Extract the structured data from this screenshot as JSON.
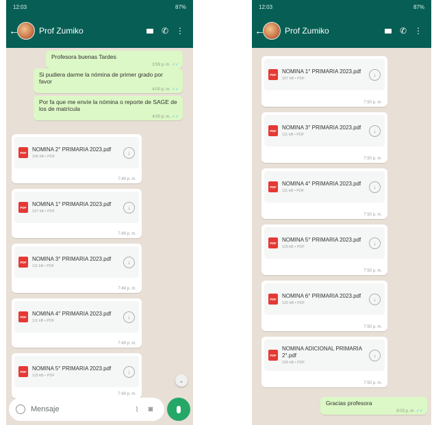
{
  "left": {
    "status_time": "12:03",
    "status_right": "87%",
    "contact_name": "Prof Zumiko",
    "text_messages": [
      {
        "text": "Profesora buenas Tardes",
        "time": "3:59 p. m."
      },
      {
        "text": "Si pudiera darme la nómina de primer grado por favor",
        "time": "4:00 p. m."
      },
      {
        "text": "Por fa que me envíe la nómina o reporte de SAGE de los de matrícula",
        "time": "4:00 p. m."
      }
    ],
    "documents": [
      {
        "name": "NOMINA 2° PRIMARIA 2023.pdf",
        "meta": "106 kB • PDF",
        "time": "7:49 p. m."
      },
      {
        "name": "NOMINA 1° PRIMARIA 2023.pdf",
        "meta": "107 kB • PDF",
        "time": "7:49 p. m."
      },
      {
        "name": "NOMINA 3° PRIMARIA 2023.pdf",
        "meta": "111 kB • PDF",
        "time": "7:49 p. m."
      },
      {
        "name": "NOMINA 4° PRIMARIA 2023.pdf",
        "meta": "111 kB • PDF",
        "time": "7:49 p. m."
      },
      {
        "name": "NOMINA 5° PRIMARIA 2023.pdf",
        "meta": "115 kB • PDF",
        "time": "7:49 p. m."
      }
    ],
    "input_placeholder": "Mensaje"
  },
  "right": {
    "status_time": "12:03",
    "status_right": "87%",
    "contact_name": "Prof Zumiko",
    "documents": [
      {
        "name": "NOMINA 1° PRIMARIA 2023.pdf",
        "meta": "107 kB • PDF",
        "time": "7:50 p. m."
      },
      {
        "name": "NOMINA 3° PRIMARIA 2023.pdf",
        "meta": "111 kB • PDF",
        "time": "7:50 p. m."
      },
      {
        "name": "NOMINA 4° PRIMARIA 2023.pdf",
        "meta": "111 kB • PDF",
        "time": "7:50 p. m."
      },
      {
        "name": "NOMINA 5° PRIMARIA 2023.pdf",
        "meta": "115 kB • PDF",
        "time": "7:50 p. m."
      },
      {
        "name": "NOMINA 6° PRIMARIA 2023.pdf",
        "meta": "120 kB • PDF",
        "time": "7:50 p. m."
      },
      {
        "name": "NOMINA ADICIONAL PRIMARIA 2°.pdf",
        "meta": "106 kB • PDF",
        "time": "7:50 p. m."
      }
    ],
    "last_message": {
      "text": "Gracias profesora",
      "time": "8:03 p. m."
    }
  },
  "icons": {
    "back": "arrow-left-icon",
    "video": "video-call-icon",
    "call": "phone-icon",
    "menu": "more-vertical-icon",
    "download": "download-icon",
    "pdf": "pdf-file-icon",
    "emoji": "emoji-icon",
    "attach": "paperclip-icon",
    "camera": "camera-icon",
    "mic": "microphone-icon",
    "scroll_down": "chevron-down-icon"
  },
  "colors": {
    "header": "#075e54",
    "outgoing_bubble": "#dcf8c6",
    "chat_background": "#e8dfd6",
    "pdf_red": "#e53935",
    "accent_green": "#25a768"
  }
}
